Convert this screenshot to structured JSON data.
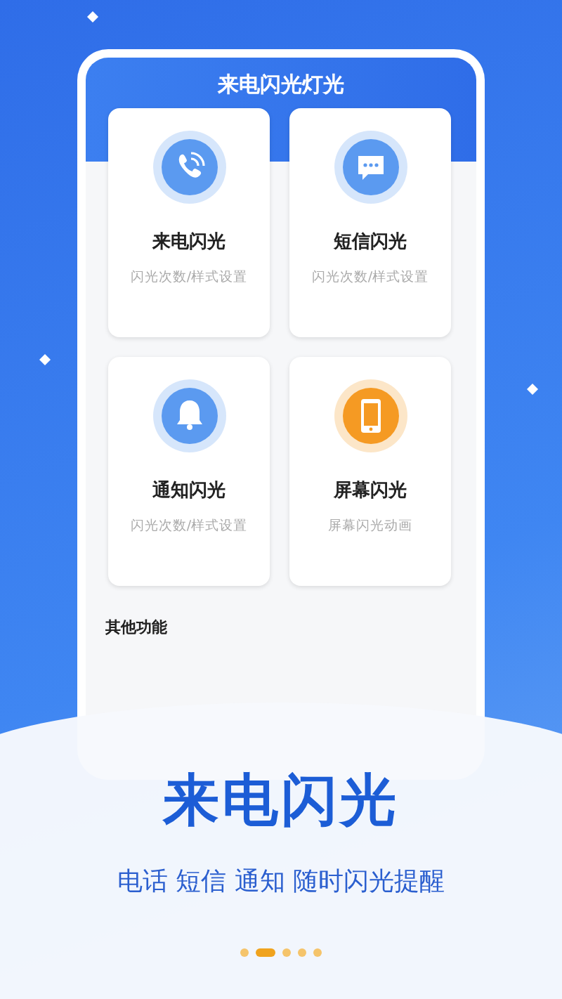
{
  "app_bar": {
    "title": "来电闪光灯光"
  },
  "features": [
    {
      "title": "来电闪光",
      "subtitle": "闪光次数/样式设置",
      "kind": "phone",
      "color": "#5b9af0"
    },
    {
      "title": "短信闪光",
      "subtitle": "闪光次数/样式设置",
      "kind": "message",
      "color": "#5b9af0"
    },
    {
      "title": "通知闪光",
      "subtitle": "闪光次数/样式设置",
      "kind": "bell",
      "color": "#5b9af0"
    },
    {
      "title": "屏幕闪光",
      "subtitle": "屏幕闪光动画",
      "kind": "screen",
      "color": "#f59a23"
    }
  ],
  "section_title": "其他功能",
  "headline": "来电闪光",
  "tagline": "电话 短信 通知 随时闪光提醒",
  "pager": [
    {
      "selected": false
    },
    {
      "selected": true
    },
    {
      "selected": false
    },
    {
      "selected": false
    },
    {
      "selected": false
    }
  ]
}
